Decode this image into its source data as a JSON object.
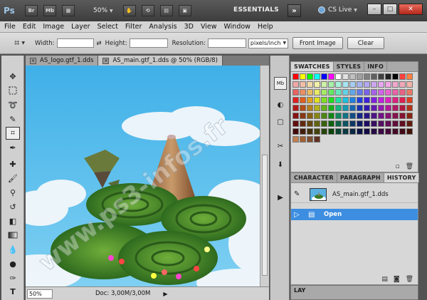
{
  "appbar": {
    "logo": "Ps",
    "buttons": [
      "Br",
      "Mb"
    ],
    "zoom": "50%",
    "workspace": "ESSENTIALS",
    "expand": "»",
    "cslive": "CS Live",
    "win_min": "–",
    "win_max": "□",
    "win_close": "✕"
  },
  "menubar": {
    "items": [
      "File",
      "Edit",
      "Image",
      "Layer",
      "Select",
      "Filter",
      "Analysis",
      "3D",
      "View",
      "Window",
      "Help"
    ]
  },
  "options": {
    "width_label": "Width:",
    "height_label": "Height:",
    "resolution_label": "Resolution:",
    "units": "pixels/inch",
    "front_image": "Front Image",
    "clear": "Clear"
  },
  "tabs": [
    {
      "label": "AS_logo.gtf_1.dds",
      "active": false
    },
    {
      "label": "AS_main.gtf_1.dds @ 50% (RGB/8)",
      "active": true
    }
  ],
  "status": {
    "zoom": "50%",
    "doc": "Doc: 3,00M/3,00M"
  },
  "panels": {
    "top_tabs": [
      "SWATCHES",
      "STYLES",
      "INFO"
    ],
    "bottom_tabs": [
      "CHARACTER",
      "PARAGRAPH",
      "HISTORY"
    ],
    "history_snapshot": "AS_main.gtf_1.dds",
    "history_state": "Open",
    "layers_tab": "LAY"
  },
  "watermark": "www.ps3-infos.fr",
  "colors": {
    "selection": "#3d8ee0",
    "sky": "#3fb0e8"
  }
}
